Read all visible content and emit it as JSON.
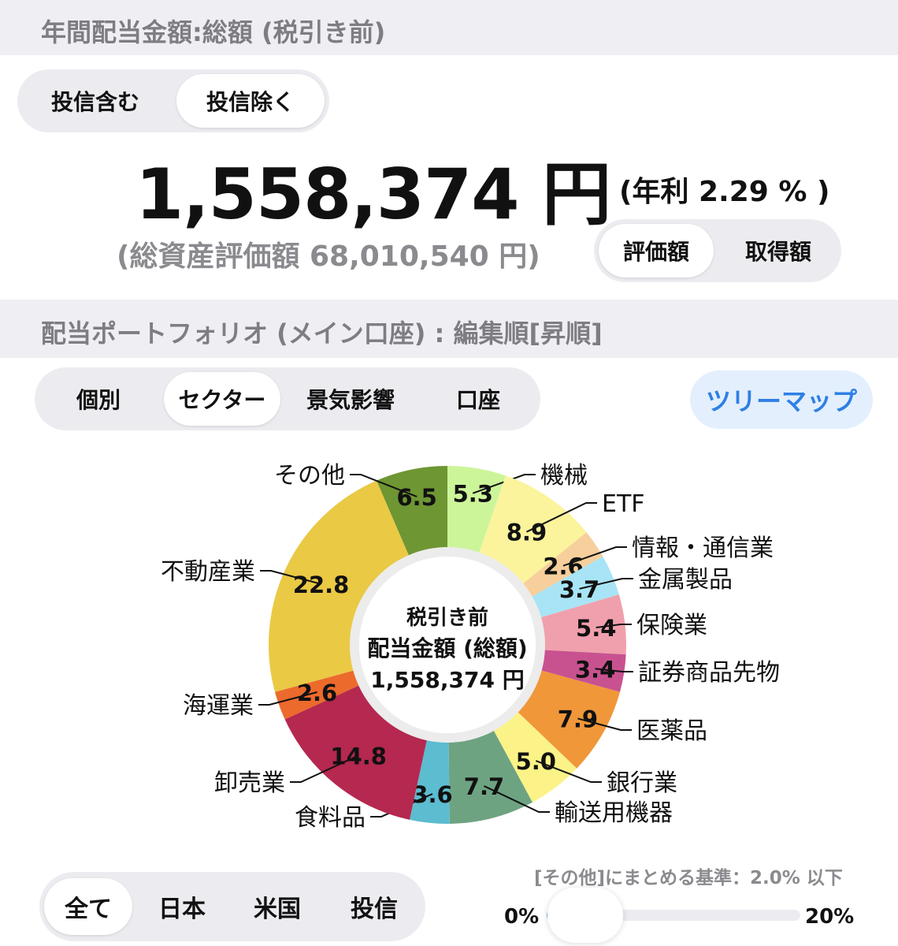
{
  "header": {
    "title": "年間配当金額:総額 (税引き前)"
  },
  "fund_toggle": {
    "options": [
      "投信含む",
      "投信除く"
    ],
    "selected": 1
  },
  "summary": {
    "amount": "1,558,374 円",
    "yield": "(年利 2.29 % )",
    "total_assets": "(総資産評価額 68,010,540 円)"
  },
  "valuation_toggle": {
    "options": [
      "評価額",
      "取得額"
    ],
    "selected": 0
  },
  "portfolio": {
    "title": "配当ポートフォリオ (メイン口座) : 編集順[昇順]"
  },
  "view_tabs": {
    "options": [
      "個別",
      "セクター",
      "景気影響",
      "口座"
    ],
    "selected": 1
  },
  "treemap_button": "ツリーマップ",
  "chart_data": {
    "type": "pie",
    "donut": true,
    "center_text": [
      "税引き前",
      "配当金額 (総額)",
      "1,558,374 円"
    ],
    "slices": [
      {
        "label": "機械",
        "value": 5.3,
        "color": "#ccf59a"
      },
      {
        "label": "ETF",
        "value": 8.9,
        "color": "#fbf49c"
      },
      {
        "label": "情報・通信業",
        "value": 2.6,
        "color": "#f7cf9c"
      },
      {
        "label": "金属製品",
        "value": 3.7,
        "color": "#a8e4f5"
      },
      {
        "label": "保険業",
        "value": 5.4,
        "color": "#f0a0ac"
      },
      {
        "label": "証券商品先物",
        "value": 3.4,
        "color": "#c85290"
      },
      {
        "label": "医薬品",
        "value": 7.9,
        "color": "#f0973a"
      },
      {
        "label": "銀行業",
        "value": 5.0,
        "color": "#fbf387"
      },
      {
        "label": "輸送用機器",
        "value": 7.7,
        "color": "#6ea382"
      },
      {
        "label": "食料品",
        "value": 3.6,
        "color": "#5cbcd0"
      },
      {
        "label": "卸売業",
        "value": 14.8,
        "color": "#b5284f"
      },
      {
        "label": "海運業",
        "value": 2.6,
        "color": "#ec6a2c"
      },
      {
        "label": "不動産業",
        "value": 22.8,
        "color": "#eac944"
      },
      {
        "label": "その他",
        "value": 6.5,
        "color": "#6e9633"
      }
    ]
  },
  "region_tabs": {
    "options": [
      "全て",
      "日本",
      "米国",
      "投信"
    ],
    "selected": 0
  },
  "threshold": {
    "caption": "[その他]にまとめる基準：2.0% 以下",
    "min_label": "0%",
    "max_label": "20%",
    "value_percent": 2.0,
    "max_percent": 20
  }
}
